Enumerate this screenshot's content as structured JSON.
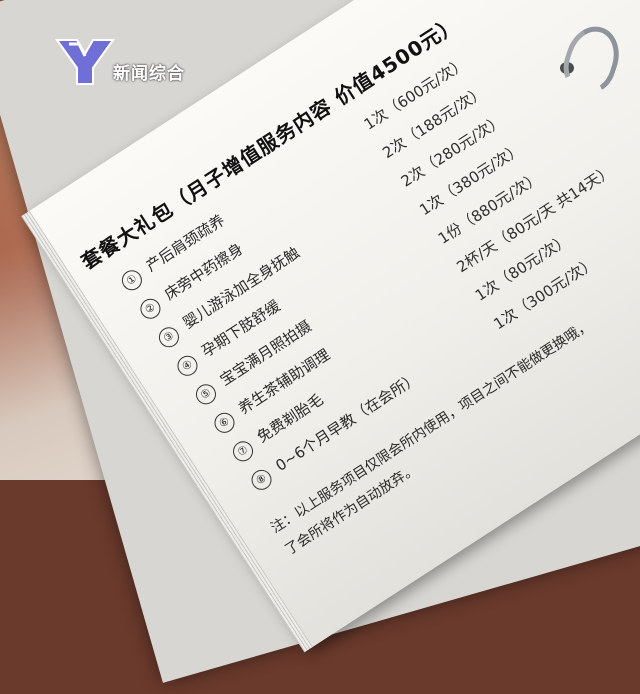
{
  "logo": {
    "text": "新闻综合",
    "colors": {
      "y_mark": "#6f6fd6",
      "text": "#ffffff"
    }
  },
  "document": {
    "title": "套餐大礼包（月子增值服务内容 价值4500元）",
    "items": [
      {
        "number": "①",
        "name": "产后肩颈疏养",
        "detail": "1次（600元/次）"
      },
      {
        "number": "②",
        "name": "床旁中药擦身",
        "detail": "2次（188元/次）"
      },
      {
        "number": "③",
        "name": "婴儿游泳加全身抚触",
        "detail": "2次（280元/次）"
      },
      {
        "number": "④",
        "name": "孕期下肢舒缓",
        "detail": "1次（380元/次）"
      },
      {
        "number": "⑤",
        "name": "宝宝满月照拍摄",
        "detail": "1份（880元/次）"
      },
      {
        "number": "⑥",
        "name": "养生茶辅助调理",
        "detail": "2杯/天（80元/天 共14天）"
      },
      {
        "number": "⑦",
        "name": "免费剃胎毛",
        "detail": "1次（80元/次）"
      },
      {
        "number": "⑧",
        "name": "0~6个月早教（在会所）",
        "detail": "1次（300元/次）"
      }
    ],
    "note_line1": "注：以上服务项目仅限会所内使用，项目之间不能做更换哦，",
    "note_line2": "了会所将作为自动放弃。"
  },
  "colors": {
    "paper": "#f6f4f0",
    "background": "#7a3c2c",
    "ink": "#1c1c1c"
  }
}
